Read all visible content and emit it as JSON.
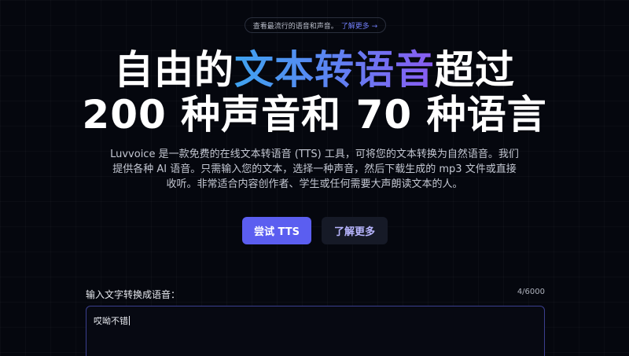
{
  "announcement": {
    "text": "查看最流行的语音和声音。",
    "link_text": "了解更多 →"
  },
  "hero": {
    "title_line1_pre": "自由的",
    "title_line1_highlight": "文本转语音",
    "title_line1_post": "超过",
    "title_line2": "200 种声音和 70 种语言",
    "description_lines": [
      "Luvvoice 是一款免费的在线文本转语音 (TTS) 工具，可将您的文本转换为自然语音。我们",
      "提供各种 AI 语音。只需输入您的文本，选择一种声音，然后下载生成的 mp3 文件或直接",
      "收听。非常适合内容创作者、学生或任何需要大声朗读文本的人。"
    ],
    "primary_button": "尝试 TTS",
    "secondary_button": "了解更多"
  },
  "input": {
    "label": "输入文字转换成语音：",
    "count": "4/6000",
    "value": "哎呦不错"
  },
  "colors": {
    "background": "#05070e",
    "primary": "#5b5ef0",
    "gradient_start": "#3fa3f0",
    "gradient_end": "#8a5cf2",
    "link": "#6f7cf5"
  }
}
